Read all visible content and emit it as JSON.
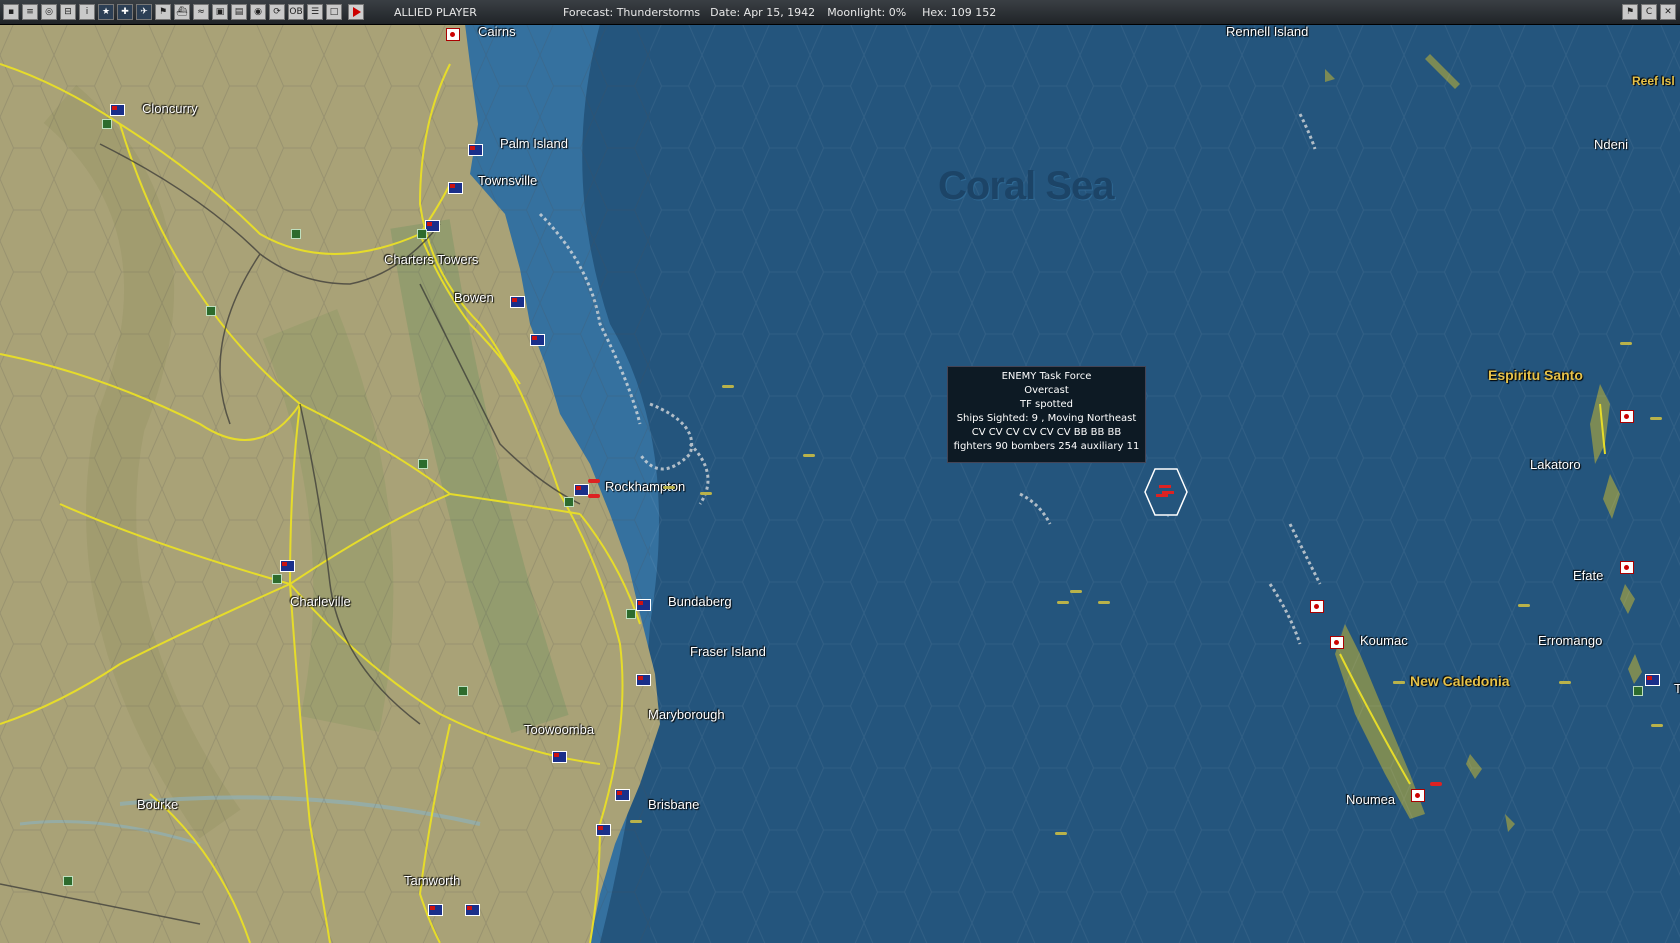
{
  "toolbar": {
    "player": "ALLIED PLAYER",
    "forecast": "Forecast: Thunderstorms",
    "date": "Date: Apr 15, 1942",
    "moonlight": "Moonlight: 0%",
    "hex": "Hex: 109 152",
    "buttons": [
      "save",
      "report",
      "intel",
      "bases",
      "info",
      "air",
      "ships",
      "squadrons",
      "flags",
      "convoys",
      "units",
      "groups",
      "map",
      "globe",
      "cycle",
      "ob",
      "list",
      "pane"
    ],
    "window_buttons": [
      "flag",
      "c",
      "close"
    ]
  },
  "map": {
    "sea_label": "Coral Sea",
    "locations": [
      {
        "name": "Cairns"
      },
      {
        "name": "Cloncurry"
      },
      {
        "name": "Palm Island"
      },
      {
        "name": "Townsville"
      },
      {
        "name": "Charters Towers"
      },
      {
        "name": "Bowen"
      },
      {
        "name": "Rockhampton"
      },
      {
        "name": "Bundaberg"
      },
      {
        "name": "Fraser Island"
      },
      {
        "name": "Charleville"
      },
      {
        "name": "Maryborough"
      },
      {
        "name": "Toowoomba"
      },
      {
        "name": "Bourke"
      },
      {
        "name": "Brisbane"
      },
      {
        "name": "Tamworth"
      },
      {
        "name": "Rennell Island"
      },
      {
        "name": "Reef Isl"
      },
      {
        "name": "Ndeni"
      },
      {
        "name": "Espiritu Santo"
      },
      {
        "name": "Lakatoro"
      },
      {
        "name": "Efate"
      },
      {
        "name": "Erromango"
      },
      {
        "name": "Koumac"
      },
      {
        "name": "New Caledonia"
      },
      {
        "name": "Noumea"
      },
      {
        "name": "T"
      }
    ]
  },
  "tooltip": {
    "line1": "ENEMY Task Force",
    "line2": "Overcast",
    "line3": "TF spotted",
    "line4": "Ships Sighted: 9 , Moving Northeast",
    "line5": "CV CV CV CV CV CV BB BB BB",
    "line6": "fighters 90  bombers 254  auxiliary 11"
  },
  "colors": {
    "land": "#a9a277",
    "sea": "#24557d",
    "shallow": "#3f7fb0",
    "roads": "#e6dc2a",
    "tooltip_bg": "#0d1a24"
  }
}
